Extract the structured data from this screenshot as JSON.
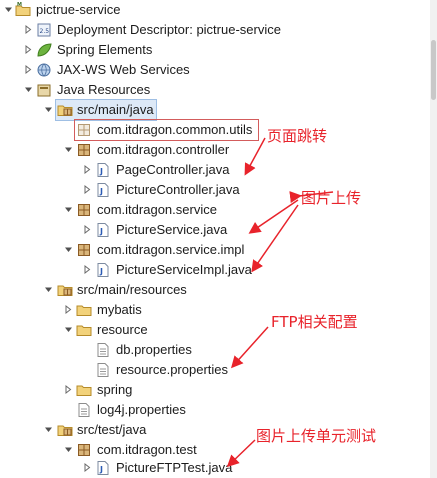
{
  "tree": {
    "project": "pictrue-service",
    "deployment_descriptor": "Deployment Descriptor: pictrue-service",
    "spring_elements": "Spring Elements",
    "jaxws": "JAX-WS Web Services",
    "java_resources": "Java Resources",
    "src_main_java": "src/main/java",
    "pkg_common_utils": "com.itdragon.common.utils",
    "pkg_controller": "com.itdragon.controller",
    "page_controller": "PageController.java",
    "picture_controller": "PictureController.java",
    "pkg_service": "com.itdragon.service",
    "picture_service": "PictureService.java",
    "pkg_service_impl": "com.itdragon.service.impl",
    "picture_service_impl": "PictureServiceImpl.java",
    "src_main_resources": "src/main/resources",
    "mybatis": "mybatis",
    "resource": "resource",
    "db_properties": "db.properties",
    "resource_properties": "resource.properties",
    "spring": "spring",
    "log4j_properties": "log4j.properties",
    "src_test_java": "src/test/java",
    "pkg_test": "com.itdragon.test",
    "picture_ftp_test": "PictureFTPTest.java"
  },
  "annotations": {
    "page_jump": "页面跳转",
    "picture_upload": "图片上传",
    "ftp_config": "FTP相关配置",
    "upload_unit_test": "图片上传单元测试"
  },
  "colors": {
    "annotation": "#e8232b",
    "selection": "#dde9f7",
    "package_icon": "#a87a3c",
    "folder_icon": "#e9c560"
  }
}
